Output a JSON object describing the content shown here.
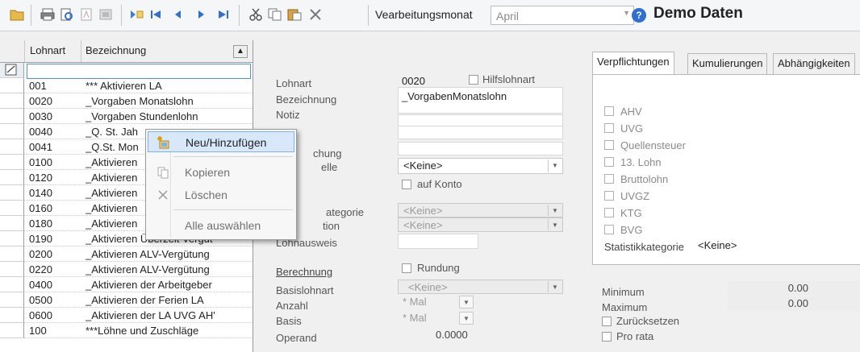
{
  "toolbar": {
    "month_label": "Vearbeitungsmonat",
    "month_value": "April",
    "demo_title": "Demo Daten"
  },
  "grid": {
    "col_lohnart": "Lohnart",
    "col_bezeichnung": "Bezeichnung",
    "rows": [
      {
        "lohnart": "001",
        "bezeichnung": "*** Aktivieren LA"
      },
      {
        "lohnart": "0020",
        "bezeichnung": "_Vorgaben Monatslohn"
      },
      {
        "lohnart": "0030",
        "bezeichnung": "_Vorgaben Stundenlohn"
      },
      {
        "lohnart": "0040",
        "bezeichnung": "_Q. St. Jah"
      },
      {
        "lohnart": "0041",
        "bezeichnung": "_Q.St. Mon"
      },
      {
        "lohnart": "0100",
        "bezeichnung": "_Aktivieren"
      },
      {
        "lohnart": "0120",
        "bezeichnung": "_Aktivieren"
      },
      {
        "lohnart": "0140",
        "bezeichnung": "_Aktivieren"
      },
      {
        "lohnart": "0160",
        "bezeichnung": "_Aktivieren"
      },
      {
        "lohnart": "0180",
        "bezeichnung": "_Aktivieren"
      },
      {
        "lohnart": "0190",
        "bezeichnung": "_Aktivieren Überzeit Vergüt"
      },
      {
        "lohnart": "0200",
        "bezeichnung": "_Aktivieren ALV-Vergütung"
      },
      {
        "lohnart": "0220",
        "bezeichnung": "_Aktivieren ALV-Vergütung"
      },
      {
        "lohnart": "0400",
        "bezeichnung": "_Aktivieren der Arbeitgeber"
      },
      {
        "lohnart": "0500",
        "bezeichnung": "_Aktivieren der Ferien LA"
      },
      {
        "lohnart": "0600",
        "bezeichnung": "_Aktivieren der LA UVG AH'"
      },
      {
        "lohnart": "100",
        "bezeichnung": "***Löhne und Zuschläge"
      }
    ]
  },
  "form": {
    "lohnart_label": "Lohnart",
    "lohnart_value": "0020",
    "hilfslohnart_label": "Hilfslohnart",
    "bezeichnung_label": "Bezeichnung",
    "bezeichnung_value": "_VorgabenMonatslohn",
    "notiz_label": "Notiz",
    "buchung_label_partial": "chung",
    "quelle_label_partial": "elle",
    "quelle_value": "<Keine>",
    "auf_konto_label": "auf Konto",
    "kategorie_label_partial": "ategorie",
    "kategorie_value": "<Keine>",
    "tion_label_partial": "tion",
    "tion_value": "<Keine>",
    "lohnausweis_label": "Lohnausweis",
    "berechnung_label": "Berechnung",
    "rundung_label": "Rundung",
    "basislohnart_label": "Basislohnart",
    "basislohnart_value": "<Keine>",
    "anzahl_label": "Anzahl",
    "anzahl_value": "* Mal",
    "basis_label": "Basis",
    "basis_value": "* Mal",
    "operand_label": "Operand",
    "operand_value": "0.0000"
  },
  "tabs": [
    {
      "label": "Verpflichtungen"
    },
    {
      "label": "Kumulierungen"
    },
    {
      "label": "Abhängigkeiten"
    }
  ],
  "obligations": [
    "AHV",
    "UVG",
    "Quellensteuer",
    "13. Lohn",
    "Bruttolohn",
    "UVGZ",
    "KTG",
    "BVG"
  ],
  "panel": {
    "statistik_label": "Statistikkategorie",
    "statistik_value": "<Keine>"
  },
  "bottom_right": {
    "minimum_label": "Minimum",
    "minimum_value": "0.00",
    "maximum_label": "Maximum",
    "maximum_value": "0.00",
    "zuruecksetzen_label": "Zurücksetzen",
    "pro_rata_label": "Pro rata"
  },
  "context_menu": {
    "items": [
      {
        "label": "Neu/Hinzufügen"
      },
      {
        "label": "Kopieren"
      },
      {
        "label": "Löschen"
      },
      {
        "label": "Alle auswählen"
      }
    ]
  }
}
